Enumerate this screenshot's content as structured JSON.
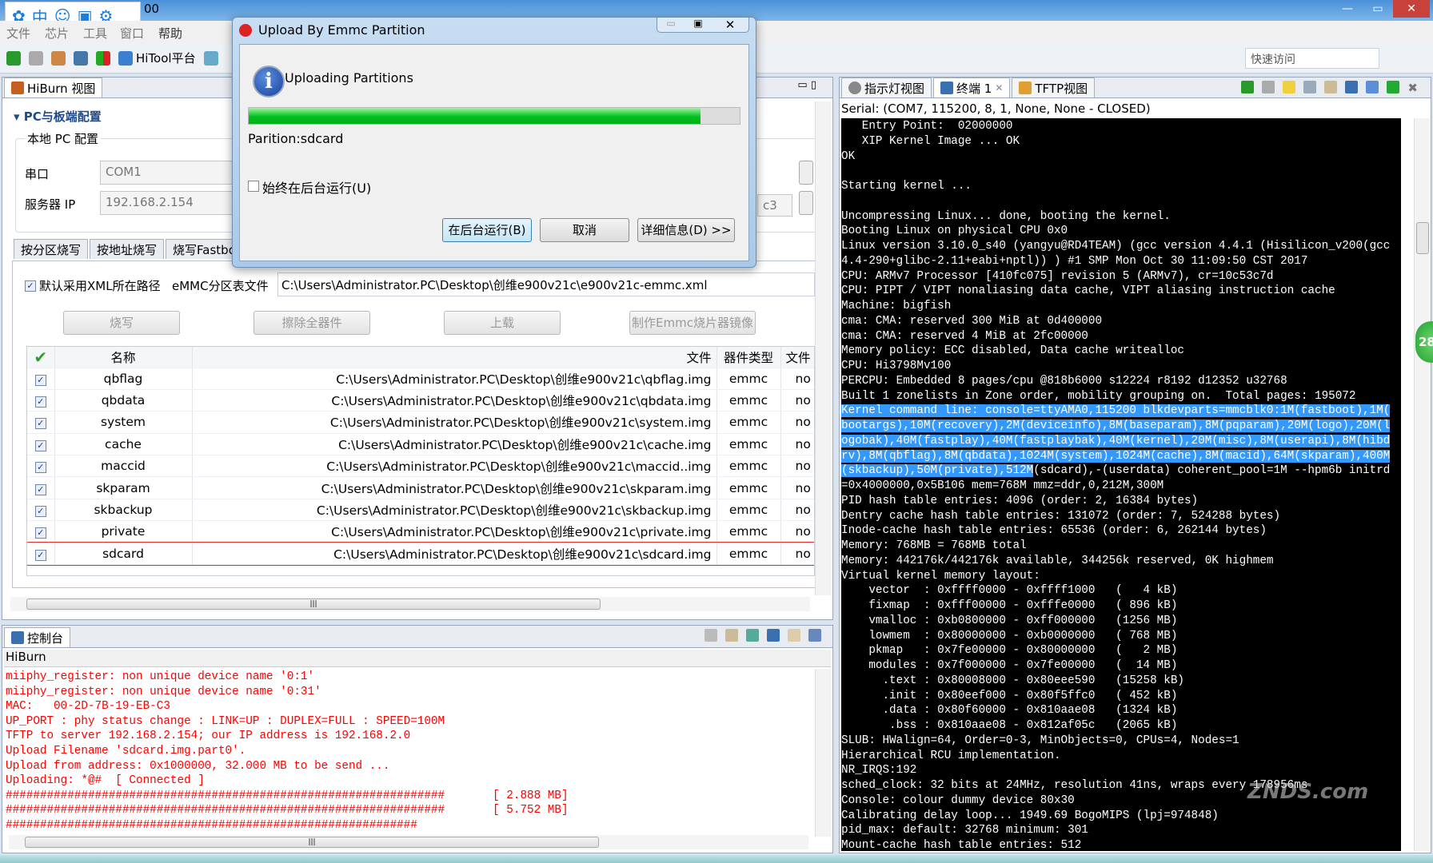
{
  "window": {
    "title_fragment": "00",
    "menu": [
      "文件",
      "芯片",
      "工具",
      "窗口",
      "帮助"
    ],
    "toolbar_label": "HiTool平台",
    "quick_access": "快速访问"
  },
  "ime": {
    "icons": [
      "paw-icon",
      "chinese-input-icon",
      "emoji-icon",
      "keyboard-icon",
      "gear-icon"
    ],
    "lang": "中"
  },
  "hiburn": {
    "tab": "HiBurn 视图",
    "section": "PC与板端配置",
    "group": "本地 PC 配置",
    "serial_label": "串口",
    "serial_value": "COM1",
    "server_label": "服务器 IP",
    "server_value": "192.168.2.154",
    "partial_value": "c3",
    "subtabs": [
      "按分区烧写",
      "按地址烧写",
      "烧写Fastboot"
    ],
    "xml_checkbox": "默认采用XML所在路径",
    "xml_label": "eMMC分区表文件",
    "xml_path": "C:\\Users\\Administrator.PC\\Desktop\\创维e900v21c\\e900v21c-emmc.xml",
    "buttons": [
      "烧写",
      "擦除全器件",
      "上载",
      "制作Emmc烧片器镜像"
    ],
    "columns": [
      "名称",
      "文件",
      "器件类型",
      "文件"
    ],
    "rows": [
      {
        "name": "qbflag",
        "file": "C:\\Users\\Administrator.PC\\Desktop\\创维e900v21c\\qbflag.img",
        "type": "emmc",
        "extra": "no"
      },
      {
        "name": "qbdata",
        "file": "C:\\Users\\Administrator.PC\\Desktop\\创维e900v21c\\qbdata.img",
        "type": "emmc",
        "extra": "no"
      },
      {
        "name": "system",
        "file": "C:\\Users\\Administrator.PC\\Desktop\\创维e900v21c\\system.img",
        "type": "emmc",
        "extra": "no"
      },
      {
        "name": "cache",
        "file": "C:\\Users\\Administrator.PC\\Desktop\\创维e900v21c\\cache.img",
        "type": "emmc",
        "extra": "no"
      },
      {
        "name": "maccid",
        "file": "C:\\Users\\Administrator.PC\\Desktop\\创维e900v21c\\maccid..img",
        "type": "emmc",
        "extra": "no"
      },
      {
        "name": "skparam",
        "file": "C:\\Users\\Administrator.PC\\Desktop\\创维e900v21c\\skparam.img",
        "type": "emmc",
        "extra": "no"
      },
      {
        "name": "skbackup",
        "file": "C:\\Users\\Administrator.PC\\Desktop\\创维e900v21c\\skbackup.img",
        "type": "emmc",
        "extra": "no"
      },
      {
        "name": "private",
        "file": "C:\\Users\\Administrator.PC\\Desktop\\创维e900v21c\\private.img",
        "type": "emmc",
        "extra": "no"
      },
      {
        "name": "sdcard",
        "file": "C:\\Users\\Administrator.PC\\Desktop\\创维e900v21c\\sdcard.img",
        "type": "emmc",
        "extra": "no",
        "selected": true
      }
    ]
  },
  "console": {
    "tab": "控制台",
    "title": "HiBurn",
    "lines": [
      "miiphy_register: non unique device name '0:1'",
      "miiphy_register: non unique device name '0:31'",
      "MAC:   00-2D-7B-19-EB-C3",
      "UP_PORT : phy status change : LINK=UP : DUPLEX=FULL : SPEED=100M",
      "TFTP to server 192.168.2.154; our IP address is 192.168.2.0",
      "Upload Filename 'sdcard.img.part0'.",
      "Upload from address: 0x1000000, 32.000 MB to be send ...",
      "Uploading: *@#  [ Connected ]",
      "################################################################       [ 2.888 MB]",
      "################################################################       [ 5.752 MB]",
      "############################################################"
    ],
    "color": "#ff0000"
  },
  "terminal": {
    "tabs": [
      "指示灯视图",
      "终端 1",
      "TFTP视图"
    ],
    "status": "Serial: (COM7, 115200, 8, 1, None, None - CLOSED)",
    "lines": [
      {
        "text": "   Entry Point:  02000000"
      },
      {
        "text": "   XIP Kernel Image ... OK"
      },
      {
        "text": "OK"
      },
      {
        "text": ""
      },
      {
        "text": "Starting kernel ..."
      },
      {
        "text": ""
      },
      {
        "text": "Uncompressing Linux... done, booting the kernel."
      },
      {
        "text": "Booting Linux on physical CPU 0x0"
      },
      {
        "text": "Linux version 3.10.0_s40 (yangyu@RD4TEAM) (gcc version 4.4.1 (Hisilicon_v200(gcc"
      },
      {
        "text": "4.4-290+glibc-2.11+eabi+nptl)) ) #1 SMP Mon Oct 30 11:09:50 CST 2017"
      },
      {
        "text": "CPU: ARMv7 Processor [410fc075] revision 5 (ARMv7), cr=10c53c7d"
      },
      {
        "text": "CPU: PIPT / VIPT nonaliasing data cache, VIPT aliasing instruction cache"
      },
      {
        "text": "Machine: bigfish"
      },
      {
        "text": "cma: CMA: reserved 300 MiB at 0d400000"
      },
      {
        "text": "cma: CMA: reserved 4 MiB at 2fc00000"
      },
      {
        "text": "Memory policy: ECC disabled, Data cache writealloc"
      },
      {
        "text": "CPU: Hi3798Mv100"
      },
      {
        "text": "PERCPU: Embedded 8 pages/cpu @818b6000 s12224 r8192 d12352 u32768"
      },
      {
        "text": "Built 1 zonelists in Zone order, mobility grouping on.  Total pages: 195072"
      },
      {
        "highlighted": "Kernel command line: console=ttyAMA0,115200 blkdevparts=mmcblk0:1M(fastboot),1M(",
        "text": ""
      },
      {
        "highlighted": "bootargs),10M(recovery),2M(deviceinfo),8M(baseparam),8M(pqparam),20M(logo),20M(l",
        "text": ""
      },
      {
        "highlighted": "ogobak),40M(fastplay),40M(fastplaybak),40M(kernel),20M(misc),8M(userapi),8M(hibd",
        "text": ""
      },
      {
        "highlighted": "rv),8M(qbflag),8M(qbdata),1024M(system),1024M(cache),8M(macid),64M(skparam),400M",
        "text": ""
      },
      {
        "highlighted": "(skbackup),50M(private),512M",
        "text": "(sdcard),-(userdata) coherent_pool=1M --hpm6b initrd"
      },
      {
        "text": "=0x4000000,0x5B106 mem=768M mmz=ddr,0,212M,300M"
      },
      {
        "text": "PID hash table entries: 4096 (order: 2, 16384 bytes)"
      },
      {
        "text": "Dentry cache hash table entries: 131072 (order: 7, 524288 bytes)"
      },
      {
        "text": "Inode-cache hash table entries: 65536 (order: 6, 262144 bytes)"
      },
      {
        "text": "Memory: 768MB = 768MB total"
      },
      {
        "text": "Memory: 442176k/442176k available, 344256k reserved, 0K highmem"
      },
      {
        "text": "Virtual kernel memory layout:"
      },
      {
        "text": "    vector  : 0xffff0000 - 0xffff1000   (   4 kB)"
      },
      {
        "text": "    fixmap  : 0xfff00000 - 0xfffe0000   ( 896 kB)"
      },
      {
        "text": "    vmalloc : 0xb0800000 - 0xff000000   (1256 MB)"
      },
      {
        "text": "    lowmem  : 0x80000000 - 0xb0000000   ( 768 MB)"
      },
      {
        "text": "    pkmap   : 0x7fe00000 - 0x80000000   (   2 MB)"
      },
      {
        "text": "    modules : 0x7f000000 - 0x7fe00000   (  14 MB)"
      },
      {
        "text": "      .text : 0x80008000 - 0x80eee590   (15258 kB)"
      },
      {
        "text": "      .init : 0x80eef000 - 0x80f5ffc0   ( 452 kB)"
      },
      {
        "text": "      .data : 0x80f60000 - 0x810aae08   (1324 kB)"
      },
      {
        "text": "       .bss : 0x810aae08 - 0x812af05c   (2065 kB)"
      },
      {
        "text": "SLUB: HWalign=64, Order=0-3, MinObjects=0, CPUs=4, Nodes=1"
      },
      {
        "text": "Hierarchical RCU implementation."
      },
      {
        "text": "NR_IRQS:192"
      },
      {
        "text": "sched_clock: 32 bits at 24MHz, resolution 41ns, wraps every 178956ms"
      },
      {
        "text": "Console: colour dummy device 80x30"
      },
      {
        "text": "Calibrating delay loop... 1949.69 BogoMIPS (lpj=974848)"
      },
      {
        "text": "pid_max: default: 32768 minimum: 301"
      },
      {
        "text": "Mount-cache hash table entries: 512"
      }
    ],
    "highlight_color": "#3399ff"
  },
  "watermark": {
    "text": "智能电视网 ZNDS.com"
  },
  "side_badge": "28",
  "dialog": {
    "title": "Upload By Emmc Partition",
    "heading": "Uploading Partitions",
    "progress_percent": 92,
    "partition": "Parition:sdcard",
    "checkbox": "始终在后台运行(U)",
    "buttons": [
      "在后台运行(B)",
      "取消",
      "详细信息(D) >>"
    ],
    "progress_color": "#00c020"
  }
}
